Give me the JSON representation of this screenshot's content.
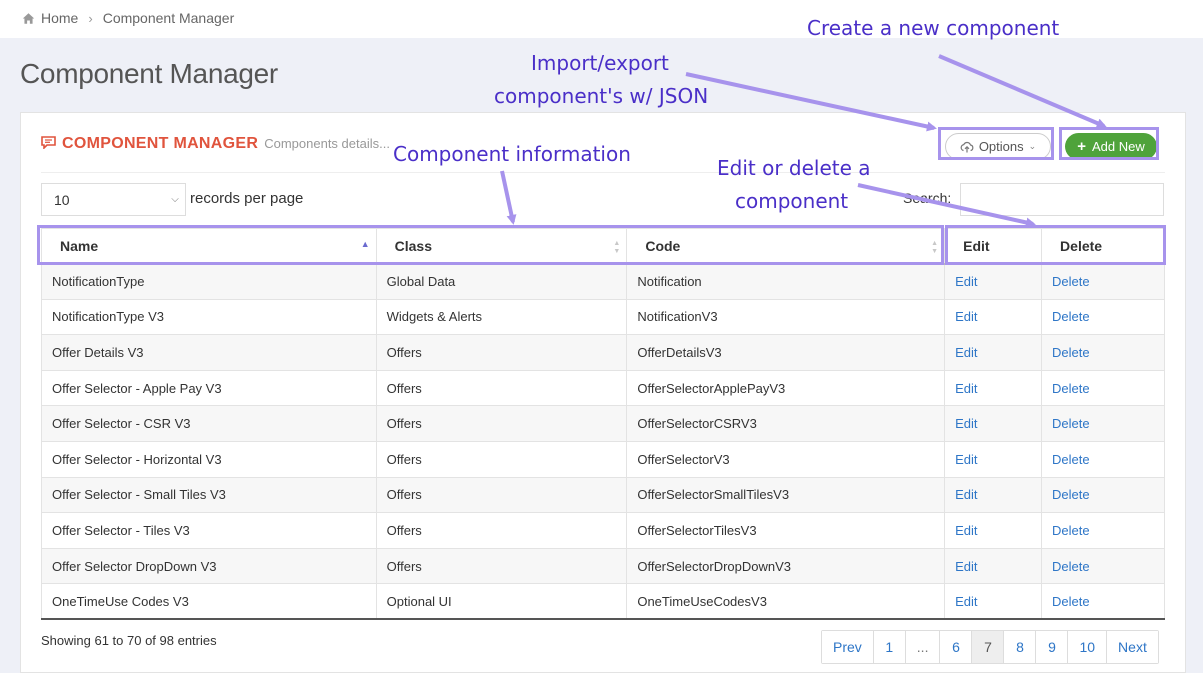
{
  "breadcrumb": {
    "home": "Home",
    "current": "Component Manager"
  },
  "page_title": "Component Manager",
  "panel": {
    "title": "COMPONENT MANAGER",
    "subtitle": "Components details...",
    "options_label": "Options",
    "add_label": "Add New",
    "accent_color": "#e0543d",
    "add_color": "#4fa33b"
  },
  "records": {
    "value": "10",
    "label": "records per page"
  },
  "search": {
    "label": "Search:",
    "value": ""
  },
  "table": {
    "columns": [
      "Name",
      "Class",
      "Code",
      "Edit",
      "Delete"
    ],
    "sort": {
      "column": "Name",
      "direction": "asc"
    },
    "rows": [
      {
        "name": "NotificationType",
        "class": "Global Data",
        "code": "Notification",
        "edit": "Edit",
        "delete": "Delete"
      },
      {
        "name": "NotificationType V3",
        "class": "Widgets & Alerts",
        "code": "NotificationV3",
        "edit": "Edit",
        "delete": "Delete"
      },
      {
        "name": "Offer Details V3",
        "class": "Offers",
        "code": "OfferDetailsV3",
        "edit": "Edit",
        "delete": "Delete"
      },
      {
        "name": "Offer Selector - Apple Pay V3",
        "class": "Offers",
        "code": "OfferSelectorApplePayV3",
        "edit": "Edit",
        "delete": "Delete"
      },
      {
        "name": "Offer Selector - CSR V3",
        "class": "Offers",
        "code": "OfferSelectorCSRV3",
        "edit": "Edit",
        "delete": "Delete"
      },
      {
        "name": "Offer Selector - Horizontal V3",
        "class": "Offers",
        "code": "OfferSelectorV3",
        "edit": "Edit",
        "delete": "Delete"
      },
      {
        "name": "Offer Selector - Small Tiles V3",
        "class": "Offers",
        "code": "OfferSelectorSmallTilesV3",
        "edit": "Edit",
        "delete": "Delete"
      },
      {
        "name": "Offer Selector - Tiles V3",
        "class": "Offers",
        "code": "OfferSelectorTilesV3",
        "edit": "Edit",
        "delete": "Delete"
      },
      {
        "name": "Offer Selector DropDown V3",
        "class": "Offers",
        "code": "OfferSelectorDropDownV3",
        "edit": "Edit",
        "delete": "Delete"
      },
      {
        "name": "OneTimeUse Codes V3",
        "class": "Optional UI",
        "code": "OneTimeUseCodesV3",
        "edit": "Edit",
        "delete": "Delete"
      }
    ]
  },
  "footer": {
    "showing": "Showing 61 to 70 of 98 entries"
  },
  "pagination": {
    "prev": "Prev",
    "pages": [
      "1",
      "...",
      "6",
      "7",
      "8",
      "9",
      "10"
    ],
    "active": "7",
    "next": "Next"
  },
  "annotations": {
    "create": "Create a new component",
    "import_line1": "Import/export",
    "import_line2": "component's w/ JSON",
    "info": "Component information",
    "edit_line1": "Edit or delete a",
    "edit_line2": "component",
    "color": "#4a2fc8",
    "highlight_color": "#a793ec"
  }
}
